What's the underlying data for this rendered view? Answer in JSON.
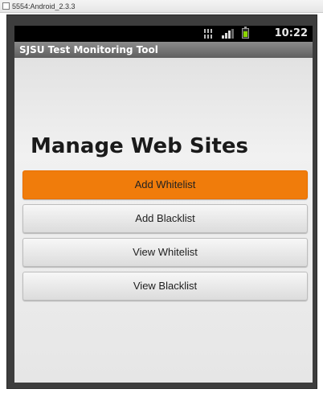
{
  "window": {
    "title": "5554:Android_2.3.3"
  },
  "status_bar": {
    "time": "10:22",
    "icons": [
      "network-icon",
      "signal-icon",
      "battery-charging-icon"
    ]
  },
  "app": {
    "title": "SJSU Test Monitoring Tool"
  },
  "main": {
    "heading": "Manage Web Sites",
    "buttons": [
      {
        "label": "Add Whitelist",
        "state": "focused"
      },
      {
        "label": "Add Blacklist",
        "state": "normal"
      },
      {
        "label": "View Whitelist",
        "state": "normal"
      },
      {
        "label": "View Blacklist",
        "state": "normal"
      }
    ]
  },
  "colors": {
    "focused_button": "#f07c0b",
    "title_bar": "#6e6e6e",
    "frame": "#3d3d3d"
  }
}
